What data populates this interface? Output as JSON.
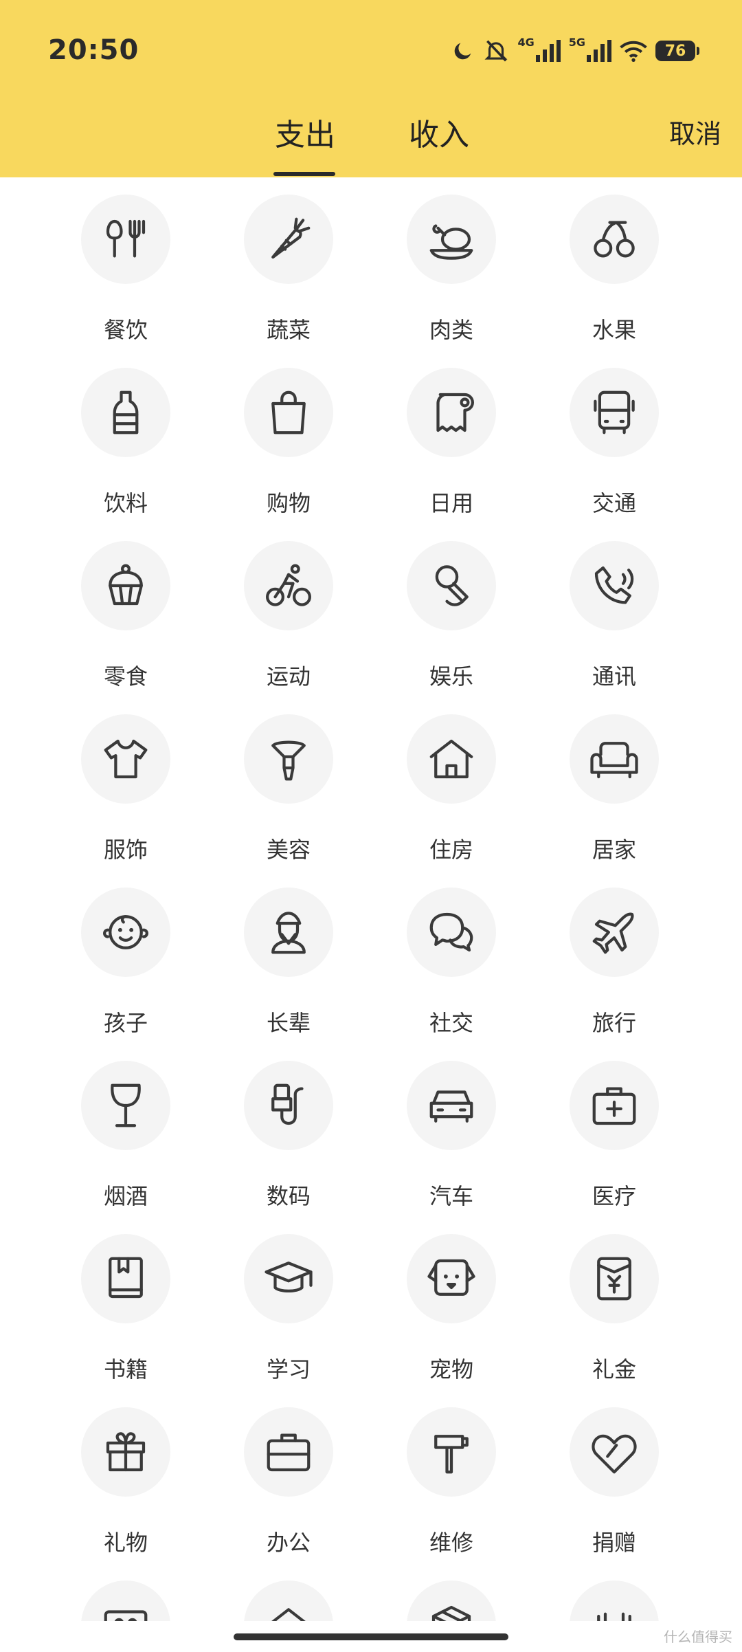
{
  "status_bar": {
    "time": "20:50",
    "network_1": "4G",
    "network_2": "5G",
    "battery": "76"
  },
  "header": {
    "tabs": [
      {
        "label": "支出",
        "active": true
      },
      {
        "label": "收入",
        "active": false
      }
    ],
    "cancel_label": "取消",
    "background_color": "#F8D85E"
  },
  "categories": [
    {
      "label": "餐饮",
      "icon": "utensils-icon"
    },
    {
      "label": "蔬菜",
      "icon": "carrot-icon"
    },
    {
      "label": "肉类",
      "icon": "chicken-leg-icon"
    },
    {
      "label": "水果",
      "icon": "cherry-icon"
    },
    {
      "label": "饮料",
      "icon": "bottle-icon"
    },
    {
      "label": "购物",
      "icon": "shopping-bag-icon"
    },
    {
      "label": "日用",
      "icon": "toilet-paper-icon"
    },
    {
      "label": "交通",
      "icon": "bus-icon"
    },
    {
      "label": "零食",
      "icon": "cupcake-icon"
    },
    {
      "label": "运动",
      "icon": "cyclist-icon"
    },
    {
      "label": "娱乐",
      "icon": "microphone-icon"
    },
    {
      "label": "通讯",
      "icon": "phone-icon"
    },
    {
      "label": "服饰",
      "icon": "tshirt-icon"
    },
    {
      "label": "美容",
      "icon": "makeup-brush-icon"
    },
    {
      "label": "住房",
      "icon": "house-icon"
    },
    {
      "label": "居家",
      "icon": "armchair-icon"
    },
    {
      "label": "孩子",
      "icon": "baby-face-icon"
    },
    {
      "label": "长辈",
      "icon": "elder-icon"
    },
    {
      "label": "社交",
      "icon": "chat-bubbles-icon"
    },
    {
      "label": "旅行",
      "icon": "airplane-icon"
    },
    {
      "label": "烟酒",
      "icon": "wine-glass-icon"
    },
    {
      "label": "数码",
      "icon": "usb-cable-icon"
    },
    {
      "label": "汽车",
      "icon": "car-icon"
    },
    {
      "label": "医疗",
      "icon": "medical-kit-icon"
    },
    {
      "label": "书籍",
      "icon": "book-icon"
    },
    {
      "label": "学习",
      "icon": "graduation-cap-icon"
    },
    {
      "label": "宠物",
      "icon": "dog-face-icon"
    },
    {
      "label": "礼金",
      "icon": "red-envelope-icon"
    },
    {
      "label": "礼物",
      "icon": "gift-icon"
    },
    {
      "label": "办公",
      "icon": "briefcase-icon"
    },
    {
      "label": "维修",
      "icon": "hammer-icon"
    },
    {
      "label": "捐赠",
      "icon": "heart-icon"
    },
    {
      "label": "",
      "icon": "ticket-icon"
    },
    {
      "label": "",
      "icon": "roof-icon"
    },
    {
      "label": "",
      "icon": "package-icon"
    },
    {
      "label": "",
      "icon": "dumbbell-icon"
    }
  ],
  "watermark": "什么值得买"
}
